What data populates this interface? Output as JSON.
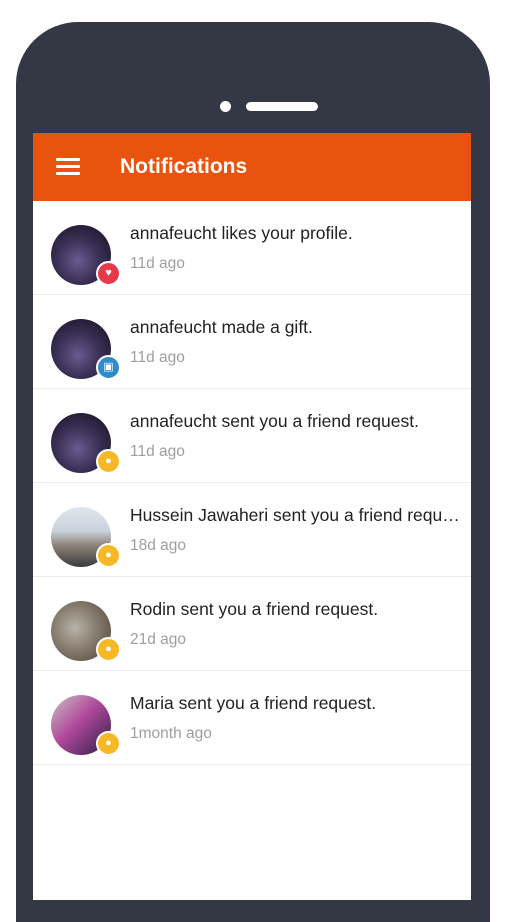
{
  "colors": {
    "accent": "#E8540E",
    "device_frame": "#333844",
    "badge_like": "#E53A4A",
    "badge_gift": "#2E8BCB",
    "badge_friend": "#F6B827"
  },
  "header": {
    "menu_icon": "hamburger-menu-icon",
    "title": "Notifications"
  },
  "notifications": [
    {
      "user": "annafeucht",
      "text": "annafeucht likes your profile.",
      "time": "11d ago",
      "badge": "heart",
      "badge_glyph": "♥",
      "badge_color": "#E53A4A",
      "avatar_bg": "radial-gradient(circle at 45% 60%, #6a5a8e 0%, #3a2f55 45%, #120f1c 100%)"
    },
    {
      "user": "annafeucht",
      "text": "annafeucht made a gift.",
      "time": "11d ago",
      "badge": "gift",
      "badge_glyph": "▣",
      "badge_color": "#2E8BCB",
      "avatar_bg": "radial-gradient(circle at 45% 60%, #6a5a8e 0%, #3a2f55 45%, #120f1c 100%)"
    },
    {
      "user": "annafeucht",
      "text": "annafeucht sent you a friend request.",
      "time": "11d ago",
      "badge": "friend",
      "badge_glyph": "●",
      "badge_color": "#F6B827",
      "avatar_bg": "radial-gradient(circle at 45% 60%, #6a5a8e 0%, #3a2f55 45%, #120f1c 100%)"
    },
    {
      "user": "Hussein Jawaheri",
      "text": "Hussein Jawaheri sent you a friend request.",
      "time": "18d ago",
      "badge": "friend",
      "badge_glyph": "●",
      "badge_color": "#F6B827",
      "avatar_bg": "linear-gradient(180deg, #dfe6ee 0%, #c9d2db 40%, #8a7f73 65%, #3b3b40 100%)"
    },
    {
      "user": "Rodin",
      "text": "Rodin sent you a friend request.",
      "time": "21d ago",
      "badge": "friend",
      "badge_glyph": "●",
      "badge_color": "#F6B827",
      "avatar_bg": "radial-gradient(circle at 40% 45%, #b8b3a8 0%, #8c8274 40%, #4a3f33 100%)"
    },
    {
      "user": "Maria",
      "text": "Maria sent you a friend request.",
      "time": "1month ago",
      "badge": "friend",
      "badge_glyph": "●",
      "badge_color": "#F6B827",
      "avatar_bg": "linear-gradient(135deg, #c9c3c7 0%, #b14a9b 45%, #5b2e66 80%, #2a2233 100%)"
    }
  ]
}
